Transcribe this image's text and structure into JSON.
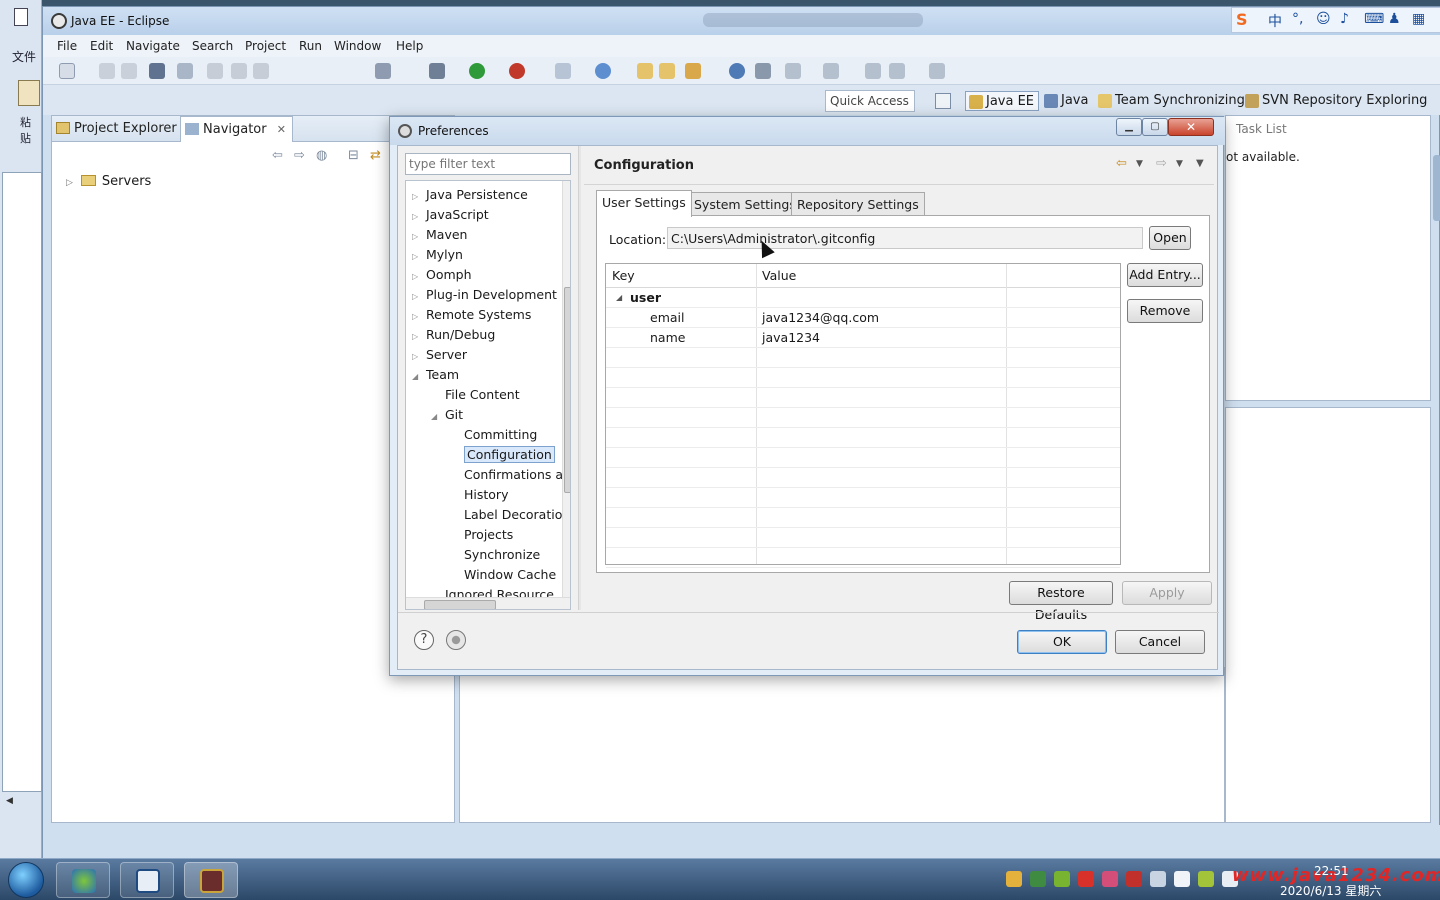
{
  "background_app": {
    "label_file": "文件",
    "label_paste": "粘贴"
  },
  "eclipse": {
    "title": "Java EE - Eclipse",
    "menu": [
      "File",
      "Edit",
      "Navigate",
      "Search",
      "Project",
      "Run",
      "Window",
      "Help"
    ],
    "quick_access": "Quick Access",
    "perspectives": [
      "Java EE",
      "Java",
      "Team Synchronizing",
      "SVN Repository Exploring"
    ],
    "left_tabs": {
      "project_explorer": "Project Explorer",
      "navigator": "Navigator"
    },
    "navigator_items": [
      "Servers"
    ],
    "right_view": {
      "task_list": "Task List",
      "message": "ot available."
    }
  },
  "ime": {
    "logo": "S",
    "mode": "中"
  },
  "preferences": {
    "title": "Preferences",
    "filter_placeholder": "type filter text",
    "tree": [
      {
        "label": "Java Persistence",
        "level": 0,
        "expander": "▷"
      },
      {
        "label": "JavaScript",
        "level": 0,
        "expander": "▷"
      },
      {
        "label": "Maven",
        "level": 0,
        "expander": "▷"
      },
      {
        "label": "Mylyn",
        "level": 0,
        "expander": "▷"
      },
      {
        "label": "Oomph",
        "level": 0,
        "expander": "▷"
      },
      {
        "label": "Plug-in Development",
        "level": 0,
        "expander": "▷"
      },
      {
        "label": "Remote Systems",
        "level": 0,
        "expander": "▷"
      },
      {
        "label": "Run/Debug",
        "level": 0,
        "expander": "▷"
      },
      {
        "label": "Server",
        "level": 0,
        "expander": "▷"
      },
      {
        "label": "Team",
        "level": 0,
        "expander": "◢"
      },
      {
        "label": "File Content",
        "level": 1,
        "expander": ""
      },
      {
        "label": "Git",
        "level": 1,
        "expander": "◢"
      },
      {
        "label": "Committing",
        "level": 2,
        "expander": ""
      },
      {
        "label": "Configuration",
        "level": 2,
        "expander": "",
        "selected": true
      },
      {
        "label": "Confirmations a",
        "level": 2,
        "expander": ""
      },
      {
        "label": "History",
        "level": 2,
        "expander": ""
      },
      {
        "label": "Label Decoratio",
        "level": 2,
        "expander": ""
      },
      {
        "label": "Projects",
        "level": 2,
        "expander": ""
      },
      {
        "label": "Synchronize",
        "level": 2,
        "expander": ""
      },
      {
        "label": "Window Cache",
        "level": 2,
        "expander": ""
      },
      {
        "label": "Ignored Resource",
        "level": 1,
        "expander": ""
      }
    ],
    "page_title": "Configuration",
    "tabs": [
      "User Settings",
      "System Settings",
      "Repository Settings"
    ],
    "active_tab": "User Settings",
    "location_label": "Location:",
    "location_value": "C:\\Users\\Administrator\\.gitconfig",
    "open_button": "Open",
    "table": {
      "columns": [
        "Key",
        "Value"
      ],
      "rows": [
        {
          "key": "user",
          "value": "",
          "section": true
        },
        {
          "key": "email",
          "value": "java1234@qq.com"
        },
        {
          "key": "name",
          "value": "java1234"
        }
      ]
    },
    "add_entry_button": "Add Entry...",
    "remove_button": "Remove",
    "restore_defaults_button": "Restore Defaults",
    "apply_button": "Apply",
    "ok_button": "OK",
    "cancel_button": "Cancel",
    "help_glyph": "?"
  },
  "taskbar": {
    "time": "22:51",
    "date": "2020/6/13 星期六",
    "watermark": "www.java1234.com"
  },
  "colors": {
    "accent_blue": "#3f7fc4",
    "selection_bg": "#d9e8fb",
    "close_red": "#c9442c"
  }
}
